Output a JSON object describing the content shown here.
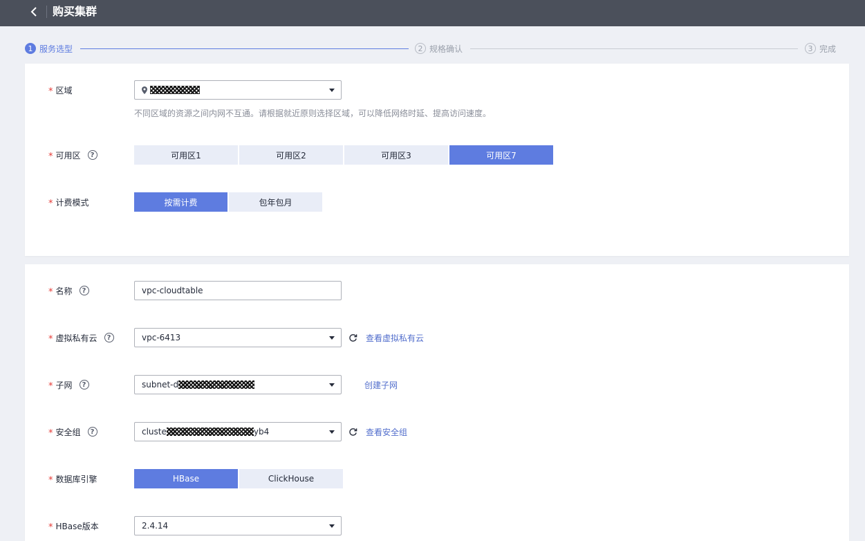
{
  "header": {
    "title": "购买集群"
  },
  "steps": [
    {
      "num": "1",
      "label": "服务选型"
    },
    {
      "num": "2",
      "label": "规格确认"
    },
    {
      "num": "3",
      "label": "完成"
    }
  ],
  "region": {
    "label": "区域",
    "hint": "不同区域的资源之间内网不互通。请根据就近原则选择区域，可以降低网络时延、提高访问速度。"
  },
  "az": {
    "label": "可用区",
    "options": [
      "可用区1",
      "可用区2",
      "可用区3",
      "可用区7"
    ],
    "selected": "可用区7"
  },
  "billing": {
    "label": "计费模式",
    "options": [
      "按需计费",
      "包年包月"
    ],
    "selected": "按需计费"
  },
  "name": {
    "label": "名称",
    "value": "vpc-cloudtable"
  },
  "vpc": {
    "label": "虚拟私有云",
    "value": "vpc-6413",
    "link": "查看虚拟私有云"
  },
  "subnet": {
    "label": "子网",
    "value_prefix": "subnet-d",
    "link": "创建子网"
  },
  "security_group": {
    "label": "安全组",
    "value_prefix": "cluste",
    "value_suffix": "yb4",
    "link": "查看安全组"
  },
  "engine": {
    "label": "数据库引擎",
    "options": [
      "HBase",
      "ClickHouse"
    ],
    "selected": "HBase"
  },
  "hbase_version": {
    "label": "HBase版本",
    "value": "2.4.14"
  },
  "colors": {
    "accent": "#5e7ce0",
    "topbar": "#4b505b",
    "required": "#e53935",
    "link": "#526ecc"
  }
}
